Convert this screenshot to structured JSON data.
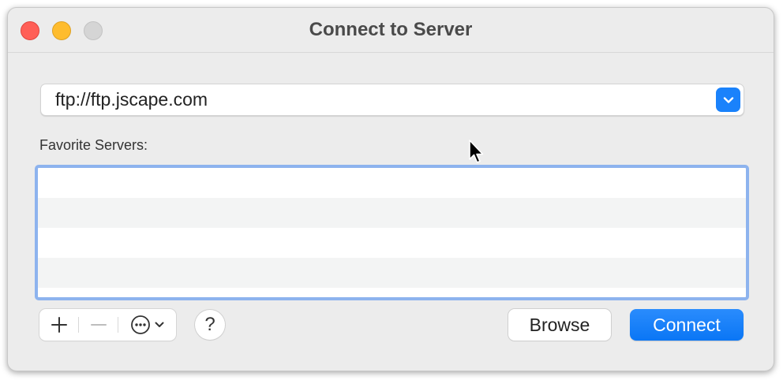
{
  "window": {
    "title": "Connect to Server"
  },
  "address": {
    "value": "ftp://ftp.jscape.com"
  },
  "favorites": {
    "label": "Favorite Servers:",
    "items": []
  },
  "toolbar": {
    "add_icon": "plus-icon",
    "remove_icon": "minus-icon",
    "more_icon": "ellipsis-circle-icon",
    "help_label": "?"
  },
  "buttons": {
    "browse_label": "Browse",
    "connect_label": "Connect"
  },
  "colors": {
    "accent": "#1a82fb",
    "list_focus_ring": "#8db3ee",
    "close": "#ff5f57",
    "minimize": "#febc2e",
    "zoom_disabled": "#d5d5d5"
  }
}
